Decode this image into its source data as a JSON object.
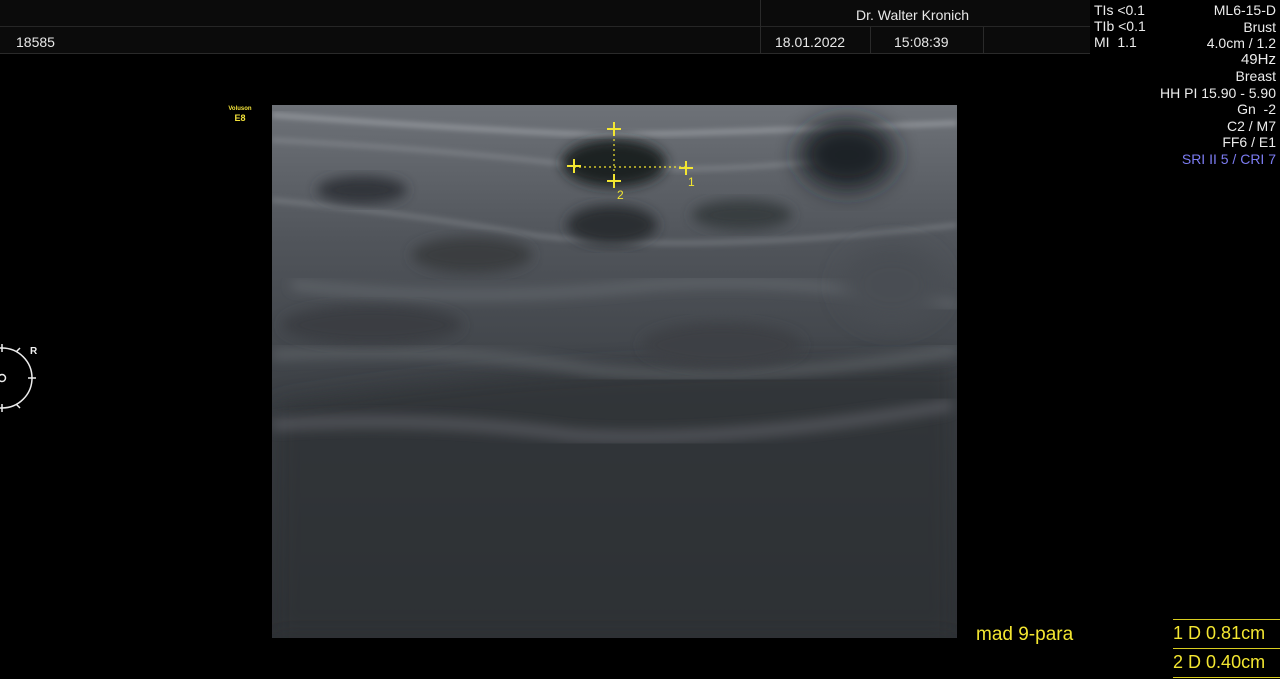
{
  "header": {
    "patient_id": "18585",
    "doctor": "Dr. Walter Kronich",
    "date": "18.01.2022",
    "time": "15:08:39"
  },
  "safety": {
    "tis": "TIs <0.1",
    "tib": "TIb <0.1",
    "mi": "MI  1.1"
  },
  "probe_info": {
    "probe": "ML6-15-D",
    "mode": "Brust",
    "depth": "4.0cm / 1.2",
    "frame_rate": "49Hz",
    "preset": "Breast",
    "hh_pi": "HH PI 15.90 - 5.90",
    "gain": "Gn  -2",
    "c_m": "C2 / M7",
    "ff_e": "FF6 / E1",
    "sri_cri": "SRI II 5 / CRI 7"
  },
  "brand": {
    "line1": "Voluson",
    "line2": "E8"
  },
  "orientation": {
    "label": "R"
  },
  "caliper_labels": {
    "one": "1",
    "two": "2"
  },
  "annotation": "mad 9-para",
  "measurements": [
    {
      "index": "1",
      "label": "D",
      "value": "0.81cm"
    },
    {
      "index": "2",
      "label": "D",
      "value": "0.40cm"
    }
  ],
  "colors": {
    "accent_yellow": "#f3e631",
    "sri_blue": "#7c7cf2",
    "background": "#000000"
  }
}
